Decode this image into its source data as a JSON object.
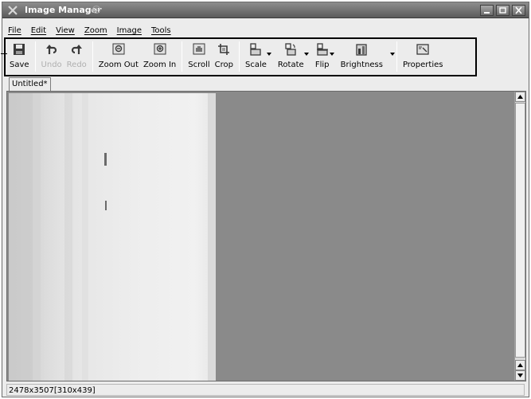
{
  "window": {
    "title": "Image Manager"
  },
  "menubar": {
    "items": [
      {
        "label": "File"
      },
      {
        "label": "Edit"
      },
      {
        "label": "View"
      },
      {
        "label": "Zoom"
      },
      {
        "label": "Image"
      },
      {
        "label": "Tools"
      }
    ]
  },
  "toolbar": {
    "save": "Save",
    "undo": "Undo",
    "redo": "Redo",
    "zoom_out": "Zoom Out",
    "zoom_in": "Zoom In",
    "scroll": "Scroll",
    "crop": "Crop",
    "scale": "Scale",
    "rotate": "Rotate",
    "flip": "Flip",
    "brightness": "Brightness",
    "properties": "Properties"
  },
  "tab": {
    "label": "Untitled*"
  },
  "status": {
    "text": "2478x3507[310x439]"
  },
  "icons": {
    "app": "x-app-icon",
    "save": "floppy-icon",
    "undo": "undo-arrow-icon",
    "redo": "redo-arrow-icon",
    "zoom_out": "zoom-out-icon",
    "zoom_in": "zoom-in-icon",
    "scroll": "hand-icon",
    "crop": "crop-icon",
    "scale": "scale-icon",
    "rotate": "rotate-icon",
    "flip": "flip-icon",
    "brightness": "brightness-icon",
    "properties": "properties-icon"
  },
  "colors": {
    "titlebar": "#6e6e6e",
    "canvas_bg": "#8a8a8a",
    "window_bg": "#ececec"
  }
}
